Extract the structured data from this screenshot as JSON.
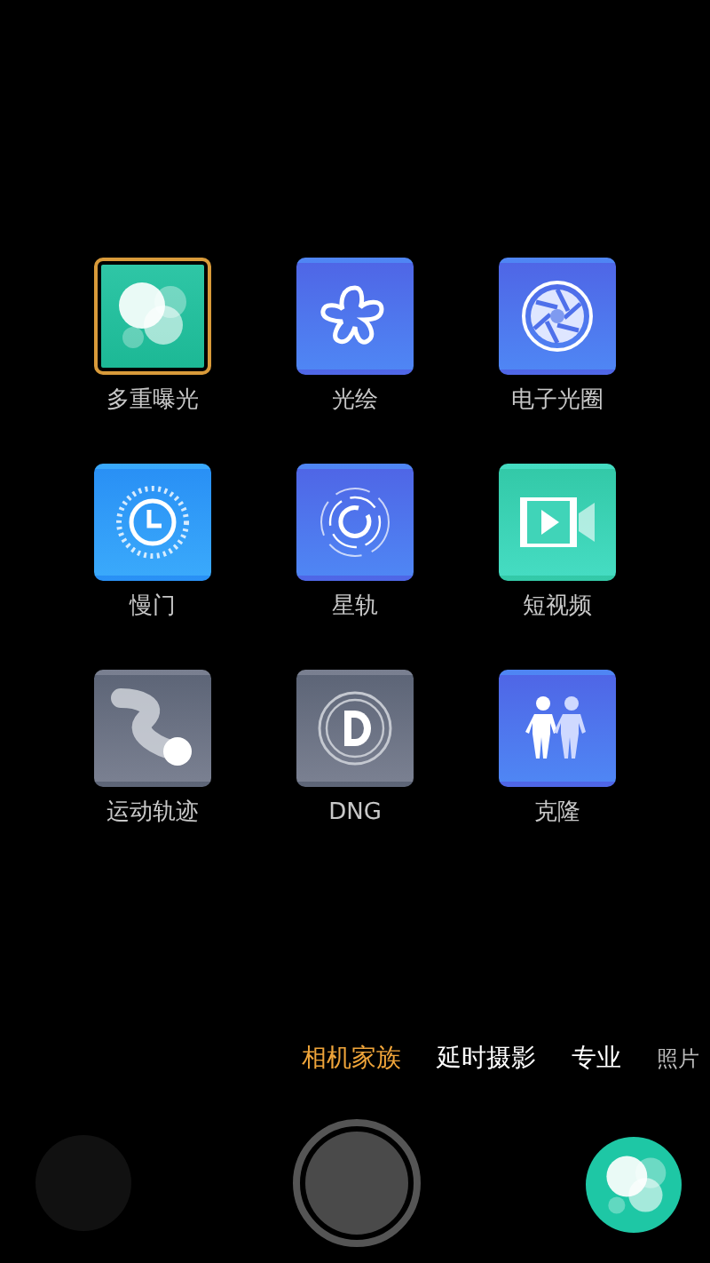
{
  "modes": [
    {
      "kind": "multi",
      "label": "多重曝光",
      "selected": true
    },
    {
      "kind": "flower",
      "label": "光绘",
      "selected": false
    },
    {
      "kind": "aperture",
      "label": "电子光圈",
      "selected": false
    },
    {
      "kind": "clock",
      "label": "慢门",
      "selected": false
    },
    {
      "kind": "trail",
      "label": "星轨",
      "selected": false
    },
    {
      "kind": "video",
      "label": "短视频",
      "selected": false
    },
    {
      "kind": "motion",
      "label": "运动轨迹",
      "selected": false
    },
    {
      "kind": "dng",
      "label": "DNG",
      "selected": false
    },
    {
      "kind": "people",
      "label": "克隆",
      "selected": false
    }
  ],
  "tabs": [
    {
      "label": "相机家族",
      "selected": true
    },
    {
      "label": "延时摄影",
      "selected": false
    },
    {
      "label": "专业",
      "selected": false
    },
    {
      "label": "照片",
      "selected": false
    }
  ]
}
